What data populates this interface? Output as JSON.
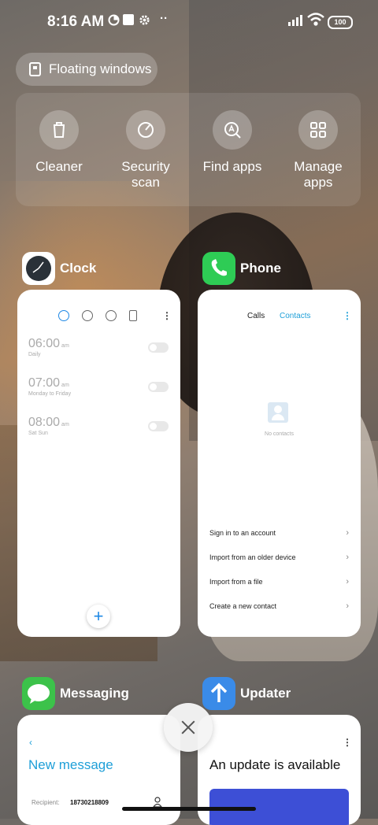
{
  "status_bar": {
    "time": "8:16 AM",
    "battery": "100",
    "more": "··"
  },
  "floating_windows": {
    "label": "Floating windows"
  },
  "quick_actions": [
    {
      "label": "Cleaner",
      "icon": "trash-icon"
    },
    {
      "label": "Security\nscan",
      "icon": "gauge-icon"
    },
    {
      "label": "Find apps",
      "icon": "search-app-icon"
    },
    {
      "label": "Manage\napps",
      "icon": "grid-icon"
    }
  ],
  "apps": {
    "clock": {
      "name": "Clock",
      "alarms": [
        {
          "time": "06:00",
          "ampm": "am",
          "repeat": "Daily"
        },
        {
          "time": "07:00",
          "ampm": "am",
          "repeat": "Monday to Friday"
        },
        {
          "time": "08:00",
          "ampm": "am",
          "repeat": "Sat Sun"
        }
      ],
      "add": "+"
    },
    "phone": {
      "name": "Phone",
      "tabs": {
        "calls": "Calls",
        "contacts": "Contacts"
      },
      "empty": "No contacts",
      "options": [
        "Sign in to an account",
        "Import from an older device",
        "Import from a file",
        "Create a new contact"
      ]
    },
    "messaging": {
      "name": "Messaging",
      "title": "New message",
      "recipient_label": "Recipient:",
      "recipient_value": "18730218809"
    },
    "updater": {
      "name": "Updater",
      "title": "An update is available"
    }
  },
  "colors": {
    "accent": "#1e9fd8",
    "phone_green": "#2ecc55",
    "messaging_green": "#3cc24a",
    "updater_blue": "#3a8be8",
    "banner_blue": "#3d4fd6"
  }
}
